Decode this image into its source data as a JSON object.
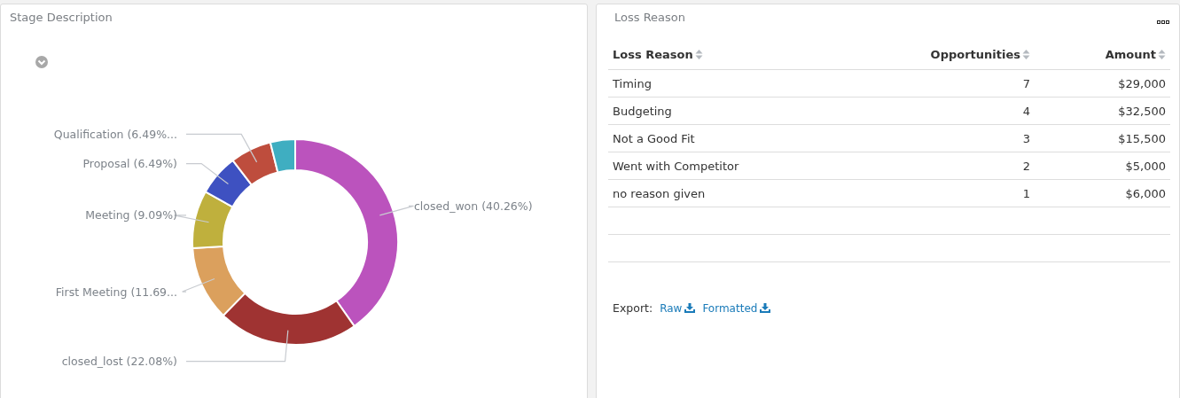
{
  "stage_panel": {
    "title": "Stage Description",
    "chart_data": {
      "type": "donut",
      "value_labels": [
        "closed_won (40.26%)",
        "closed_lost (22.08%)",
        "First Meeting (11.69...",
        "Meeting (9.09%)",
        "Proposal (6.49%)",
        "Qualification (6.49%...",
        null
      ],
      "values": [
        40.26,
        22.08,
        11.69,
        9.09,
        6.49,
        6.49,
        3.9
      ],
      "colors": [
        "#bb53bd",
        "#9f3332",
        "#dba05d",
        "#bfb03d",
        "#3e51c1",
        "#be4d3d",
        "#3faec1"
      ]
    }
  },
  "loss_panel": {
    "title": "Loss Reason",
    "table": {
      "columns": [
        {
          "label": "Loss Reason",
          "kind": "text"
        },
        {
          "label": "Opportunities",
          "kind": "number"
        },
        {
          "label": "Amount",
          "kind": "number"
        }
      ],
      "rows": [
        [
          "Timing",
          "7",
          "$29,000"
        ],
        [
          "Budgeting",
          "4",
          "$32,500"
        ],
        [
          "Not a Good Fit",
          "3",
          "$15,500"
        ],
        [
          "Went with Competitor",
          "2",
          "$5,000"
        ],
        [
          "no reason given",
          "1",
          "$6,000"
        ]
      ]
    },
    "export": {
      "label": "Export:",
      "links": [
        "Raw",
        "Formatted"
      ]
    }
  }
}
